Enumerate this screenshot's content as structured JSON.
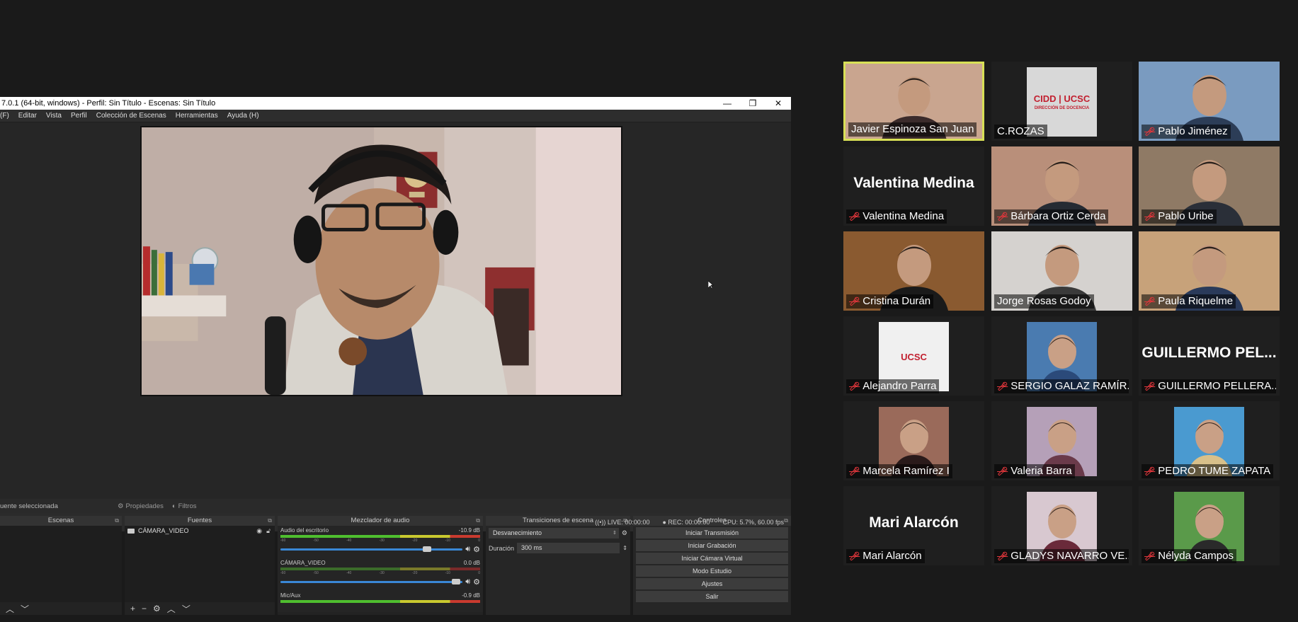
{
  "obs": {
    "title": "7.0.1 (64-bit, windows) - Perfil: Sin Título - Escenas: Sin Título",
    "window_buttons": [
      "—",
      "❐",
      "✕"
    ],
    "menu": [
      "(F)",
      "Editar",
      "Vista",
      "Perfil",
      "Colección de Escenas",
      "Herramientas",
      "Ayuda (H)"
    ],
    "props_bar": {
      "selected": "uente seleccionada",
      "properties": "Propiedades",
      "filters": "Filtros"
    },
    "docks": {
      "scenes": {
        "title": "Escenas"
      },
      "sources": {
        "title": "Fuentes",
        "items": [
          {
            "label": "CÁMARA_VIDEO"
          }
        ]
      },
      "mixer": {
        "title": "Mezclador de audio",
        "channels": [
          {
            "name": "Audio del escritorio",
            "db": "-10.9 dB",
            "level": 0.78
          },
          {
            "name": "CÁMARA_VIDEO",
            "db": "0.0 dB",
            "level": 1.0
          },
          {
            "name": "Mic/Aux",
            "db": "-0.9 dB",
            "level": 0.97
          }
        ],
        "ticks": [
          "-60",
          "-55",
          "-50",
          "-45",
          "-40",
          "-35",
          "-30",
          "-25",
          "-20",
          "-15",
          "-10",
          "-5",
          "0"
        ]
      },
      "transitions": {
        "title": "Transiciones de escena",
        "type": "Desvanecimiento",
        "duration_label": "Duración",
        "duration": "300 ms"
      },
      "controls": {
        "title": "Controles",
        "buttons": [
          "Iniciar Transmisión",
          "Iniciar Grabación",
          "Iniciar Cámara Virtual",
          "Modo Estudio",
          "Ajustes",
          "Salir"
        ]
      }
    },
    "status": {
      "live": "LIVE: 00:00:00",
      "rec": "REC: 00:00:00",
      "cpu": "CPU: 5.7%, 60.00 fps"
    }
  },
  "participants": [
    {
      "name": "Javier Espinoza San Juan",
      "muted": false,
      "active": true,
      "kind": "video"
    },
    {
      "name": "C.ROZAS",
      "muted": false,
      "kind": "logo",
      "logo_text": [
        "CIDD | UCSC",
        "DIRECCIÓN DE DOCENCIA"
      ]
    },
    {
      "name": "Pablo Jiménez",
      "muted": true,
      "kind": "video"
    },
    {
      "name": "Valentina Medina",
      "muted": true,
      "kind": "text",
      "display": "Valentina Medina"
    },
    {
      "name": "Bárbara Ortiz Cerda",
      "muted": true,
      "kind": "video"
    },
    {
      "name": "Pablo Uribe",
      "muted": true,
      "kind": "video"
    },
    {
      "name": "Cristina Durán",
      "muted": true,
      "kind": "video"
    },
    {
      "name": "Jorge Rosas Godoy",
      "muted": false,
      "kind": "video"
    },
    {
      "name": "Paula Riquelme",
      "muted": true,
      "kind": "video"
    },
    {
      "name": "Alejandro Parra",
      "muted": true,
      "kind": "logo",
      "logo_text": [
        "UCSC"
      ]
    },
    {
      "name": "SERGIO GALAZ RAMÍR...",
      "muted": true,
      "kind": "photo"
    },
    {
      "name": "GUILLERMO PELLERA...",
      "muted": true,
      "kind": "text",
      "display": "GUILLERMO PEL..."
    },
    {
      "name": "Marcela Ramírez I",
      "muted": true,
      "kind": "photo"
    },
    {
      "name": "Valeria Barra",
      "muted": true,
      "kind": "photo"
    },
    {
      "name": "PEDRO TUME ZAPATA",
      "muted": true,
      "kind": "photo"
    },
    {
      "name": "Mari Alarcón",
      "muted": true,
      "kind": "text",
      "display": "Mari Alarcón"
    },
    {
      "name": "GLADYS NAVARRO VE...",
      "muted": true,
      "kind": "photo"
    },
    {
      "name": "Nélyda Campos",
      "muted": true,
      "kind": "photo"
    }
  ],
  "icons": {
    "muted": "mic-off-icon",
    "eye": "eye-icon",
    "lock": "lock-icon",
    "gear": "gear-icon",
    "speaker": "speaker-icon"
  },
  "colors": {
    "active_speaker_border": "#d8e056",
    "mute_red": "#e0363b",
    "background": "#1a1a1a"
  }
}
